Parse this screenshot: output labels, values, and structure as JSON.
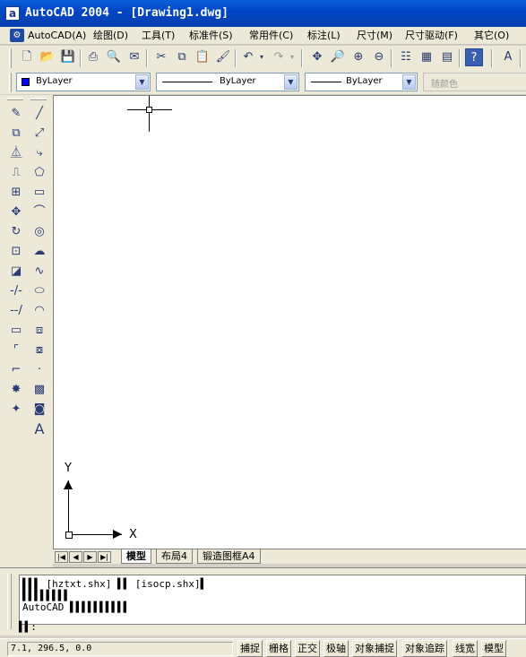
{
  "window": {
    "title": "AutoCAD 2004 - [Drawing1.dwg]",
    "app_icon": "a"
  },
  "menu": {
    "mdi_icon": "⚙",
    "items": [
      "AutoCAD(A)",
      "绘图(D)",
      "工具(T)",
      "标准件(S)",
      "常用件(C)",
      "标注(L)",
      "尺寸(M)",
      "尺寸驱动(F)",
      "其它(O)"
    ]
  },
  "properties": {
    "layer": "ByLayer",
    "linetype": "ByLayer",
    "lineweight": "ByLayer",
    "plotstyle": "随颜色"
  },
  "tabs": [
    "模型",
    "布局4",
    "锻造图框A4"
  ],
  "active_tab": "模型",
  "command": {
    "lines": [
      "▌▌▌ [hztxt.shx] ▌▌ [isocp.shx]▌",
      "▌▌▌▌▌▌▌▌",
      "AutoCAD ▌▌▌▌▌▌▌▌▌▌"
    ],
    "prompt": "▌▌:"
  },
  "status": {
    "coords": "7.1,   296.5, 0.0",
    "buttons": [
      "捕捉",
      "栅格",
      "正交",
      "极轴",
      "对象捕捉",
      "对象追踪",
      "线宽",
      "模型"
    ]
  },
  "ucs": {
    "y": "Y",
    "x": "X"
  },
  "colors": {
    "title_bar": "#0046c7",
    "canvas": "#ffffff",
    "chrome": "#ece9d8"
  }
}
